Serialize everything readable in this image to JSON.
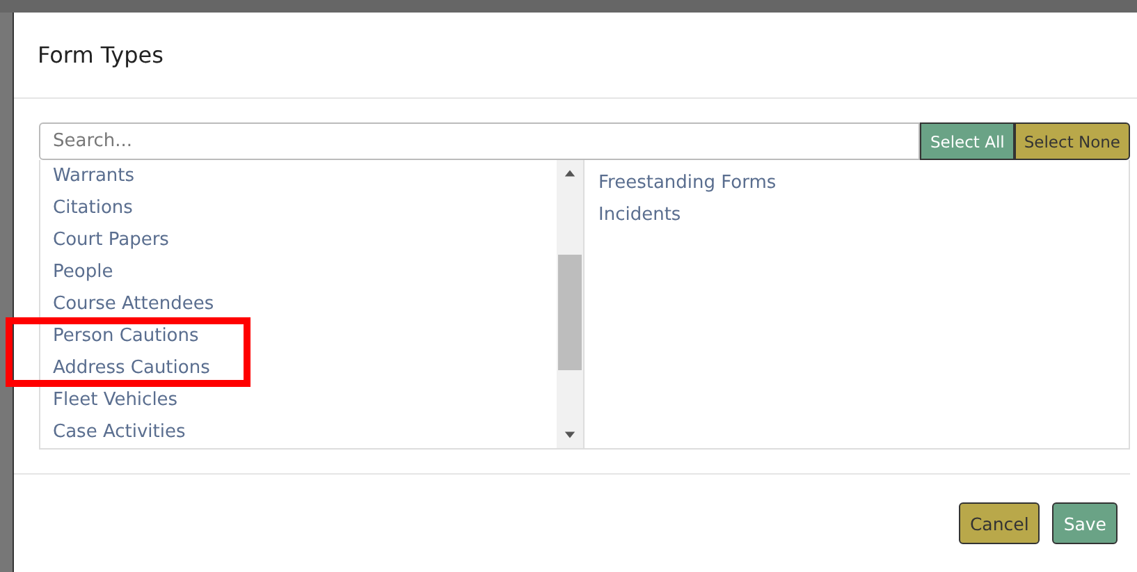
{
  "dialog": {
    "title": "Form Types"
  },
  "search": {
    "placeholder": "Search..."
  },
  "toolbar_buttons": [
    {
      "label": "Select All",
      "kind": "positive"
    },
    {
      "label": "Select None",
      "kind": "neutral"
    }
  ],
  "available_list": {
    "items": [
      {
        "label": "Warrants"
      },
      {
        "label": "Citations"
      },
      {
        "label": "Court Papers"
      },
      {
        "label": "People"
      },
      {
        "label": "Course Attendees"
      },
      {
        "label": "Person Cautions",
        "highlighted": true
      },
      {
        "label": "Address Cautions",
        "highlighted": true
      },
      {
        "label": "Fleet Vehicles"
      },
      {
        "label": "Case Activities"
      }
    ]
  },
  "selected_list": {
    "items": [
      {
        "label": "Freestanding Forms"
      },
      {
        "label": "Incidents"
      }
    ]
  },
  "footer_buttons": [
    {
      "label": "Cancel",
      "kind": "neutral"
    },
    {
      "label": "Save",
      "kind": "positive"
    }
  ]
}
